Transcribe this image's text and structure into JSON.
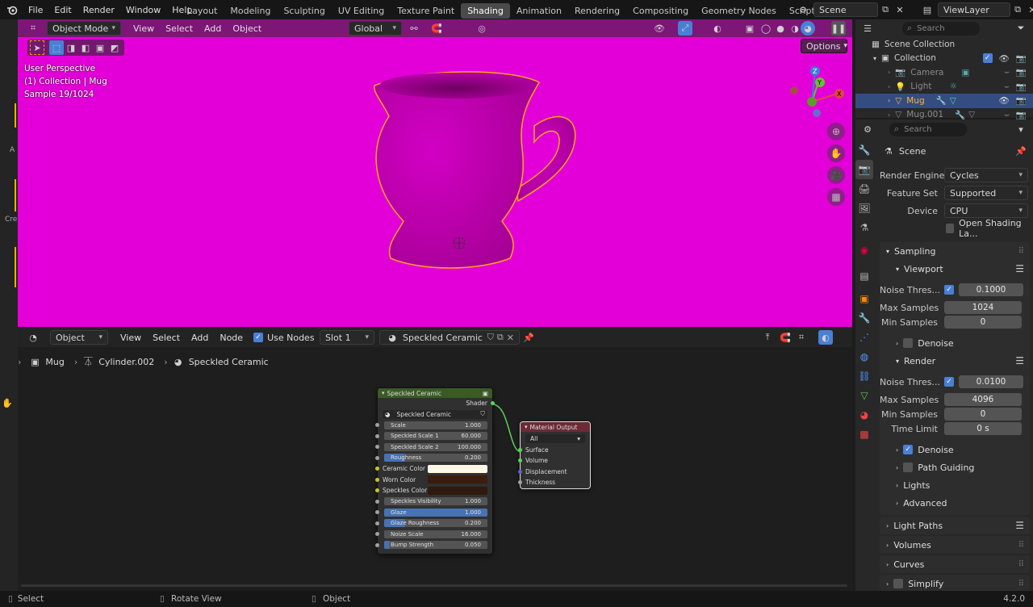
{
  "menubar": {
    "items": [
      "File",
      "Edit",
      "Render",
      "Window",
      "Help"
    ],
    "workspaces": [
      "Layout",
      "Modeling",
      "Sculpting",
      "UV Editing",
      "Texture Paint",
      "Shading",
      "Animation",
      "Rendering",
      "Compositing",
      "Geometry Nodes",
      "Scripting"
    ],
    "active_workspace": "Shading",
    "add_tab": "+",
    "scene": "Scene",
    "view_layer": "ViewLayer"
  },
  "viewport": {
    "mode": "Object Mode",
    "menus": [
      "View",
      "Select",
      "Add",
      "Object"
    ],
    "orientation": "Global",
    "options": "Options",
    "info_line1": "User Perspective",
    "info_line2": "(1) Collection | Mug",
    "info_line3": "Sample 19/1024",
    "bg_color": "#e300d8",
    "gizmo": {
      "x": "X",
      "y": "Y",
      "z": "Z"
    }
  },
  "node_editor": {
    "type": "Object",
    "menus": [
      "View",
      "Select",
      "Add",
      "Node"
    ],
    "use_nodes": "Use Nodes",
    "slot": "Slot 1",
    "material": "Speckled Ceramic",
    "breadcrumb": [
      "Mug",
      "Cylinder.002",
      "Speckled Ceramic"
    ],
    "group_node": {
      "title": "Speckled Ceramic",
      "output": "Shader",
      "datablock": "Speckled Ceramic",
      "inputs": [
        {
          "label": "Scale",
          "value": "1.000",
          "fill": 0
        },
        {
          "label": "Speckled Scale 1",
          "value": "60.000",
          "fill": 0
        },
        {
          "label": "Speckled Scale 2",
          "value": "100.000",
          "fill": 0
        },
        {
          "label": "Roughness",
          "value": "0.200",
          "fill": 0.2
        },
        {
          "label": "Ceramic Color",
          "color": "#fdf7e8"
        },
        {
          "label": "Worn Color",
          "color": "#3b1c0d"
        },
        {
          "label": "Speckles Color",
          "color": "#2e1a0e"
        },
        {
          "label": "Speckles Visibility",
          "value": "1.000",
          "fill": 0
        },
        {
          "label": "Glaze",
          "value": "1.000",
          "fill": 1
        },
        {
          "label": "Glaze Roughness",
          "value": "0.200",
          "fill": 0.2
        },
        {
          "label": "Noize Scale",
          "value": "16.000",
          "fill": 0
        },
        {
          "label": "Bump Strength",
          "value": "0.050",
          "fill": 0.05
        }
      ]
    },
    "output_node": {
      "title": "Material Output",
      "target": "All",
      "sockets": [
        "Surface",
        "Volume",
        "Displacement",
        "Thickness"
      ]
    }
  },
  "outliner": {
    "search_placeholder": "Search",
    "items": [
      {
        "label": "Scene Collection",
        "indent": 0
      },
      {
        "label": "Collection",
        "indent": 1
      },
      {
        "label": "Camera",
        "indent": 2
      },
      {
        "label": "Light",
        "indent": 2
      },
      {
        "label": "Mug",
        "indent": 2,
        "selected": true
      },
      {
        "label": "Mug.001",
        "indent": 2
      }
    ]
  },
  "properties": {
    "search_placeholder": "Search",
    "context": "Scene",
    "render_engine_label": "Render Engine",
    "render_engine": "Cycles",
    "feature_set_label": "Feature Set",
    "feature_set": "Supported",
    "device_label": "Device",
    "device": "CPU",
    "osl_label": "Open Shading La...",
    "sampling": "Sampling",
    "viewport_label": "Viewport",
    "vp_noise_label": "Noise Thres...",
    "vp_noise": "0.1000",
    "vp_max_label": "Max Samples",
    "vp_max": "1024",
    "vp_min_label": "Min Samples",
    "vp_min": "0",
    "vp_denoise": "Denoise",
    "render_label": "Render",
    "r_noise_label": "Noise Thres...",
    "r_noise": "0.0100",
    "r_max_label": "Max Samples",
    "r_max": "4096",
    "r_min_label": "Min Samples",
    "r_min": "0",
    "r_time_label": "Time Limit",
    "r_time": "0 s",
    "r_denoise": "Denoise",
    "path_guiding": "Path Guiding",
    "lights": "Lights",
    "advanced": "Advanced",
    "light_paths": "Light Paths",
    "volumes": "Volumes",
    "curves": "Curves",
    "simplify": "Simplify"
  },
  "statusbar": {
    "select": "Select",
    "rotate": "Rotate View",
    "object": "Object",
    "version": "4.2.0"
  },
  "left_strip": {
    "label_a": "A",
    "label_cre": "Cre"
  }
}
